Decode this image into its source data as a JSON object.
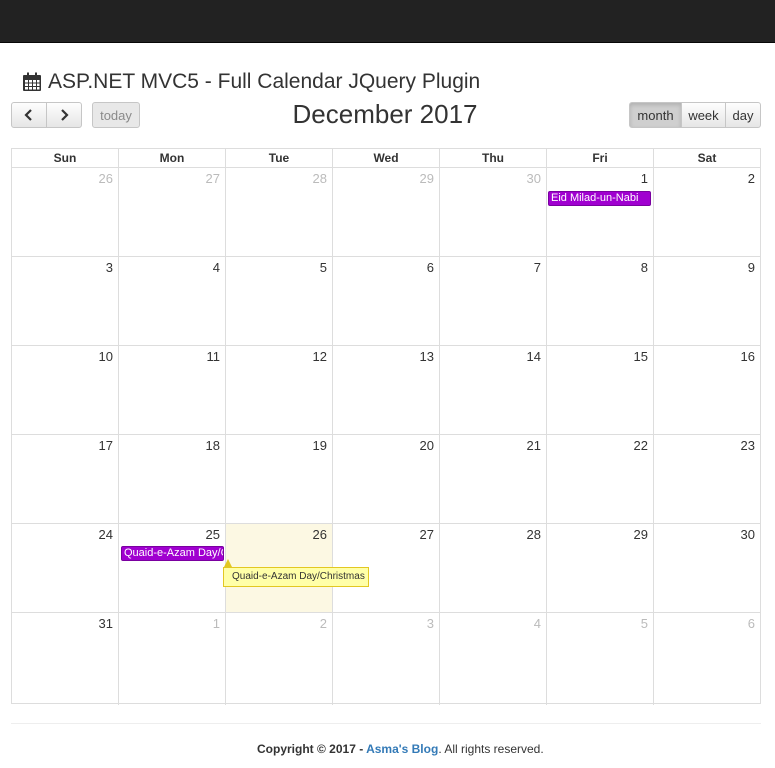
{
  "page": {
    "title": "ASP.NET MVC5 - Full Calendar JQuery Plugin"
  },
  "toolbar": {
    "prev_icon": "chevron-left-icon",
    "next_icon": "chevron-right-icon",
    "today_label": "today",
    "month_label": "month",
    "week_label": "week",
    "day_label": "day",
    "active_view": "month"
  },
  "calendar": {
    "title": "December 2017",
    "days_of_week": [
      "Sun",
      "Mon",
      "Tue",
      "Wed",
      "Thu",
      "Fri",
      "Sat"
    ],
    "weeks": [
      [
        {
          "d": "26",
          "other": true
        },
        {
          "d": "27",
          "other": true
        },
        {
          "d": "28",
          "other": true
        },
        {
          "d": "29",
          "other": true
        },
        {
          "d": "30",
          "other": true
        },
        {
          "d": "1"
        },
        {
          "d": "2"
        }
      ],
      [
        {
          "d": "3"
        },
        {
          "d": "4"
        },
        {
          "d": "5"
        },
        {
          "d": "6"
        },
        {
          "d": "7"
        },
        {
          "d": "8"
        },
        {
          "d": "9"
        }
      ],
      [
        {
          "d": "10"
        },
        {
          "d": "11"
        },
        {
          "d": "12"
        },
        {
          "d": "13"
        },
        {
          "d": "14"
        },
        {
          "d": "15"
        },
        {
          "d": "16"
        }
      ],
      [
        {
          "d": "17"
        },
        {
          "d": "18"
        },
        {
          "d": "19"
        },
        {
          "d": "20"
        },
        {
          "d": "21"
        },
        {
          "d": "22"
        },
        {
          "d": "23"
        }
      ],
      [
        {
          "d": "24"
        },
        {
          "d": "25"
        },
        {
          "d": "26",
          "today": true
        },
        {
          "d": "27"
        },
        {
          "d": "28"
        },
        {
          "d": "29"
        },
        {
          "d": "30"
        }
      ],
      [
        {
          "d": "31"
        },
        {
          "d": "1",
          "other": true
        },
        {
          "d": "2",
          "other": true
        },
        {
          "d": "3",
          "other": true
        },
        {
          "d": "4",
          "other": true
        },
        {
          "d": "5",
          "other": true
        },
        {
          "d": "6",
          "other": true
        }
      ]
    ],
    "events": [
      {
        "title": "Eid Milad-un-Nabi",
        "date": "1"
      },
      {
        "title": "Quaid-e-Azam Day/C",
        "date": "25"
      }
    ],
    "event_color": "#a000d0",
    "today_highlight": "#fcf8e3",
    "tooltip": "Quaid-e-Azam Day/Christmas"
  },
  "footer": {
    "copyright": "Copyright © 2017 - ",
    "link_text": "Asma's Blog",
    "suffix": ". All rights reserved."
  }
}
